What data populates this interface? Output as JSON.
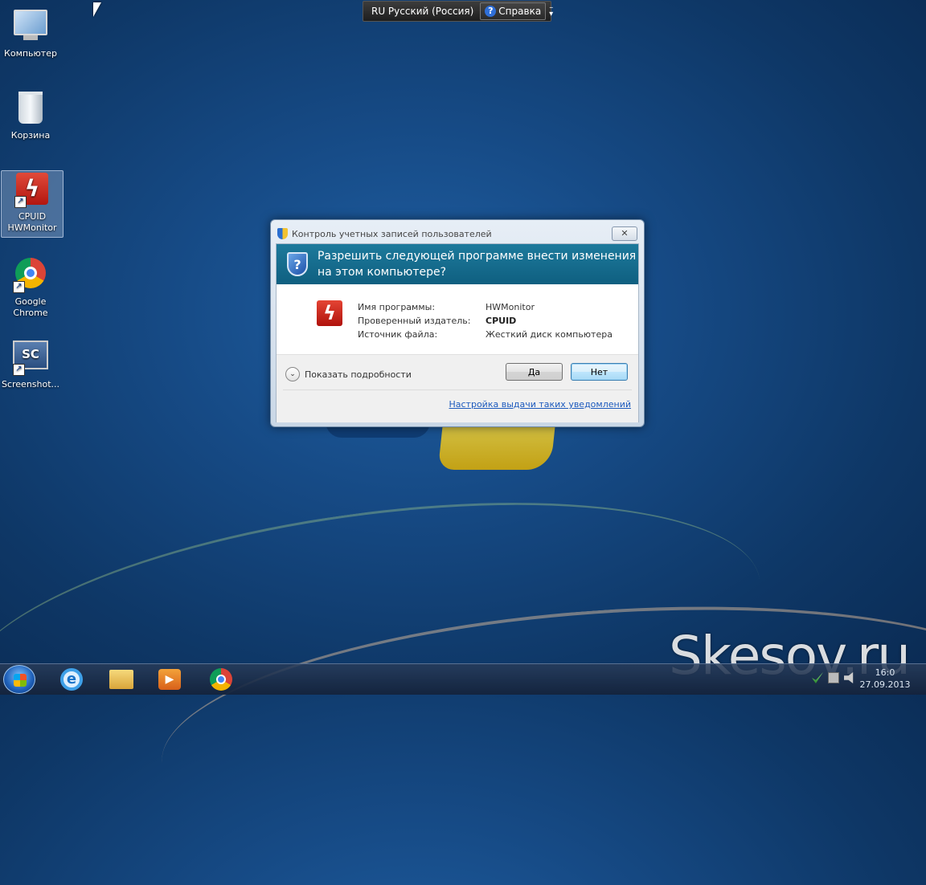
{
  "langbar": {
    "language": "RU Русский (Россия)",
    "help_label": "Справка"
  },
  "desktop_icons": [
    {
      "label": "Компьютер"
    },
    {
      "label": "Корзина"
    },
    {
      "label": "CPUID HWMonitor"
    },
    {
      "label": "Google Chrome"
    },
    {
      "label": "Screenshot..."
    }
  ],
  "dialog": {
    "title": "Контроль учетных записей пользователей",
    "close_label": "✕",
    "question": "Разрешить следующей программе внести изменения на этом компьютере?",
    "fields": [
      {
        "label": "Имя программы:",
        "value": "HWMonitor"
      },
      {
        "label": "Проверенный издатель:",
        "value": "CPUID"
      },
      {
        "label": "Источник файла:",
        "value": "Жесткий диск компьютера"
      }
    ],
    "show_details": "Показать подробности",
    "yes_label": "Да",
    "no_label": "Нет",
    "settings_link": "Настройка выдачи таких уведомлений"
  },
  "taskbar": {
    "time": "16:0",
    "date": "27.09.2013"
  },
  "watermark": "Skesov.ru",
  "colors": {
    "banner": "#1d7a9c",
    "link": "#1c5abd"
  }
}
